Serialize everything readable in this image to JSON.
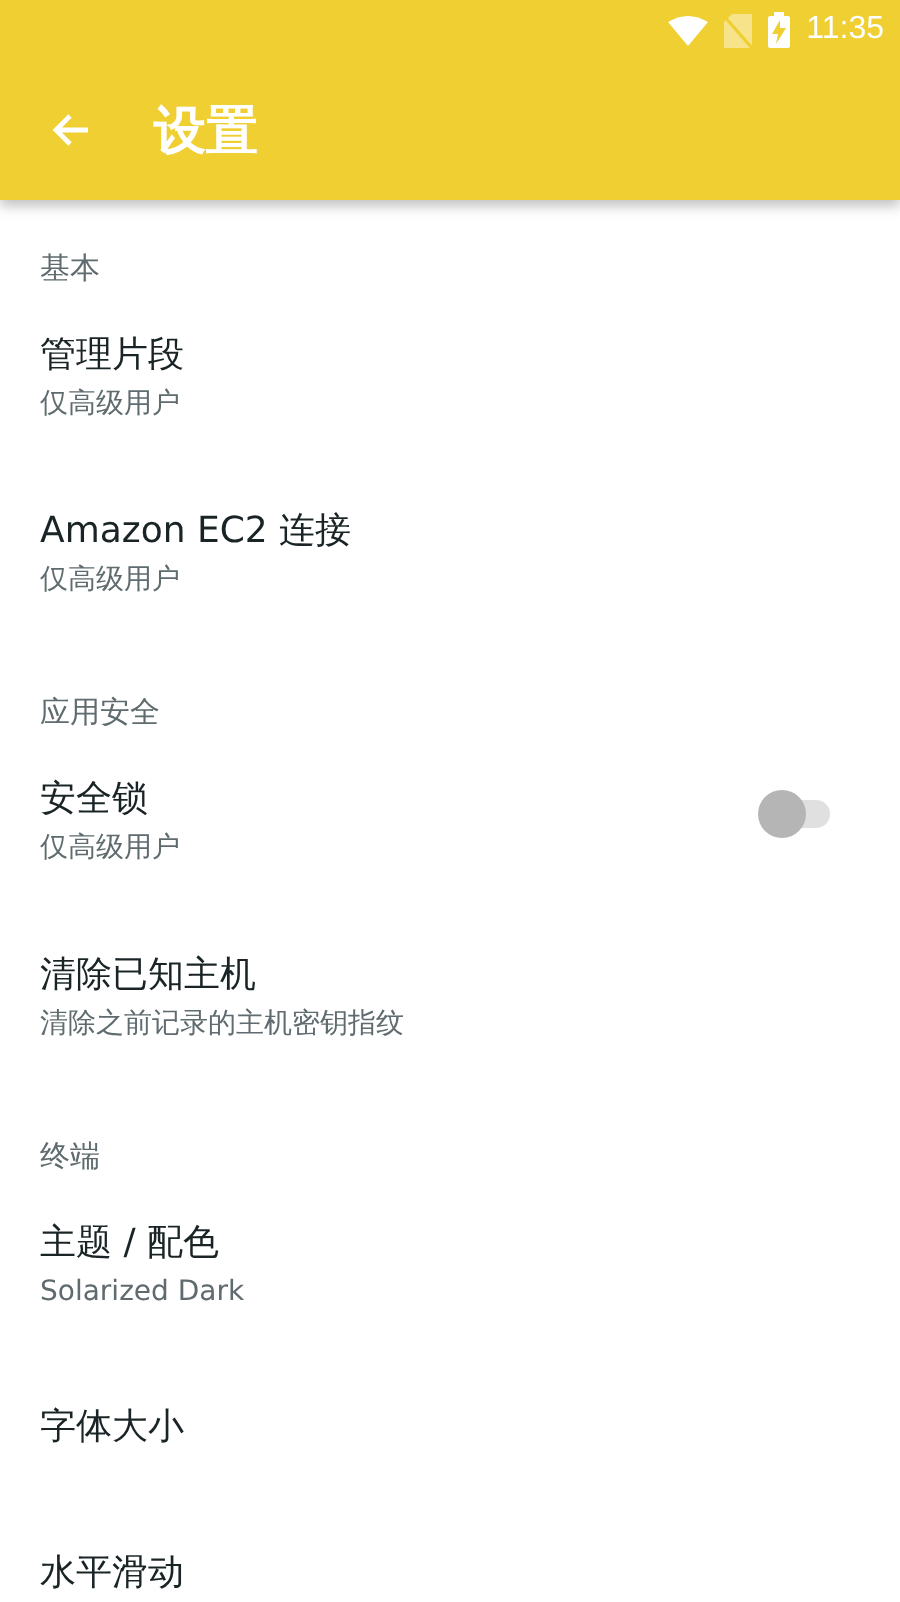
{
  "status_bar": {
    "time": "11:35"
  },
  "toolbar": {
    "title": "设置"
  },
  "sections": [
    {
      "header": "基本",
      "items": [
        {
          "kind": "plain",
          "title": "管理片段",
          "subtitle": "仅高级用户"
        },
        {
          "kind": "plain",
          "title": "Amazon EC2 连接",
          "subtitle": "仅高级用户"
        }
      ]
    },
    {
      "header": "应用安全",
      "items": [
        {
          "kind": "switch",
          "title": "安全锁",
          "subtitle": "仅高级用户",
          "on": false
        },
        {
          "kind": "plain",
          "title": "清除已知主机",
          "subtitle": "清除之前记录的主机密钥指纹"
        }
      ]
    },
    {
      "header": "终端",
      "items": [
        {
          "kind": "plain",
          "title": "主题 / 配色",
          "subtitle": "Solarized Dark"
        },
        {
          "kind": "plain",
          "title": "字体大小"
        },
        {
          "kind": "plain",
          "title": "水平滑动"
        }
      ]
    }
  ]
}
